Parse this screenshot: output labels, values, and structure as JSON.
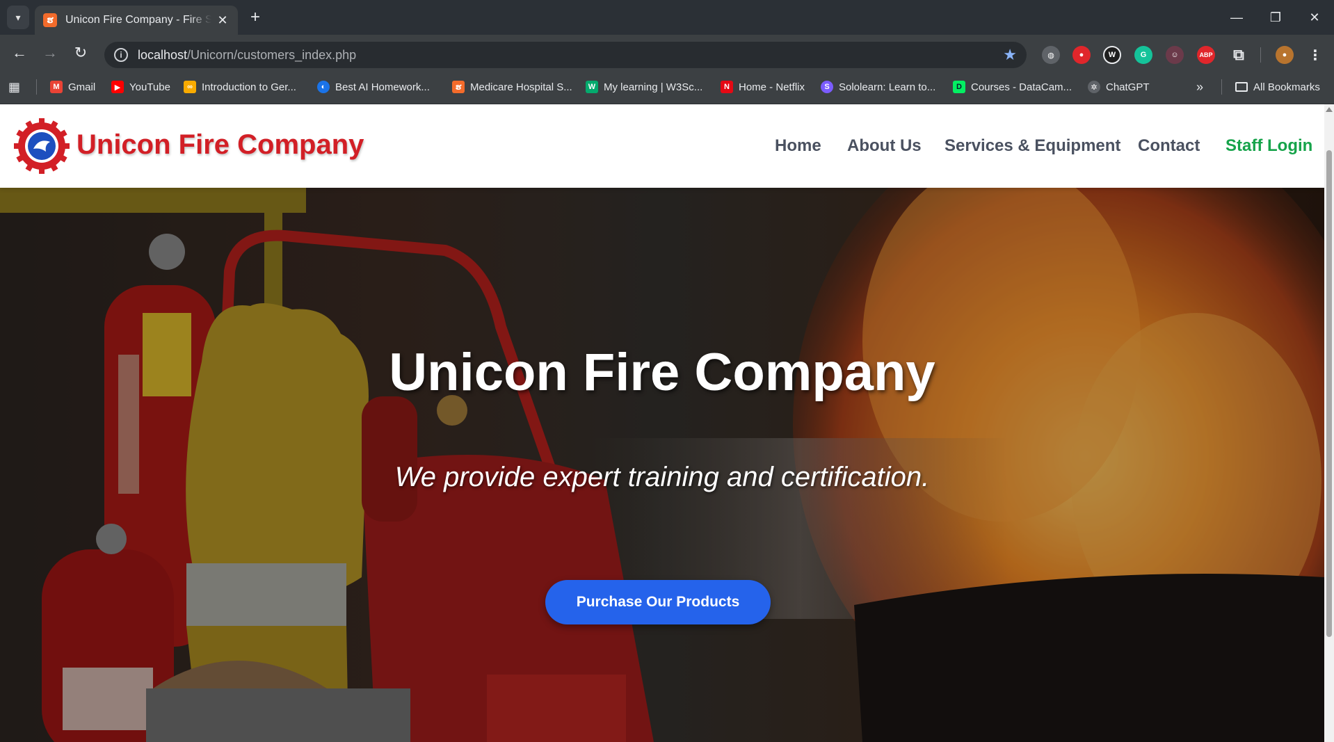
{
  "browser": {
    "tab_title": "Unicon Fire Company - Fire Safety",
    "url_host": "localhost",
    "url_path": "/Unicorn/customers_index.php",
    "bookmarks": [
      {
        "label": "Gmail",
        "icon": "gmail-icon",
        "color": "#ea4335"
      },
      {
        "label": "YouTube",
        "icon": "youtube-icon",
        "color": "#ff0000"
      },
      {
        "label": "Introduction to Ger...",
        "icon": "colab-icon",
        "color": "#f9ab00"
      },
      {
        "label": "Best AI Homework...",
        "icon": "ai-homework-icon",
        "color": "#1a73e8"
      },
      {
        "label": "Medicare Hospital S...",
        "icon": "xampp-icon",
        "color": "#f36b2b"
      },
      {
        "label": "My learning | W3Sc...",
        "icon": "w3schools-icon",
        "color": "#04aa6d"
      },
      {
        "label": "Home - Netflix",
        "icon": "netflix-icon",
        "color": "#e50914"
      },
      {
        "label": "Sololearn: Learn to...",
        "icon": "sololearn-icon",
        "color": "#7b5cff"
      },
      {
        "label": "Courses - DataCam...",
        "icon": "datacamp-icon",
        "color": "#03ef62"
      },
      {
        "label": "ChatGPT",
        "icon": "chatgpt-icon",
        "color": "#a0a0a0"
      }
    ],
    "all_bookmarks_label": "All Bookmarks"
  },
  "site": {
    "brand": "Unicon Fire Company",
    "brand_color": "#d21f26",
    "nav": {
      "home": "Home",
      "about": "About Us",
      "services": "Services & Equipment",
      "contact": "Contact",
      "staff_login": "Staff Login"
    },
    "hero": {
      "title": "Unicon Fire Company",
      "subtitle": "We provide expert training and certification.",
      "cta": "Purchase Our Products",
      "cta_color": "#2563eb"
    }
  }
}
